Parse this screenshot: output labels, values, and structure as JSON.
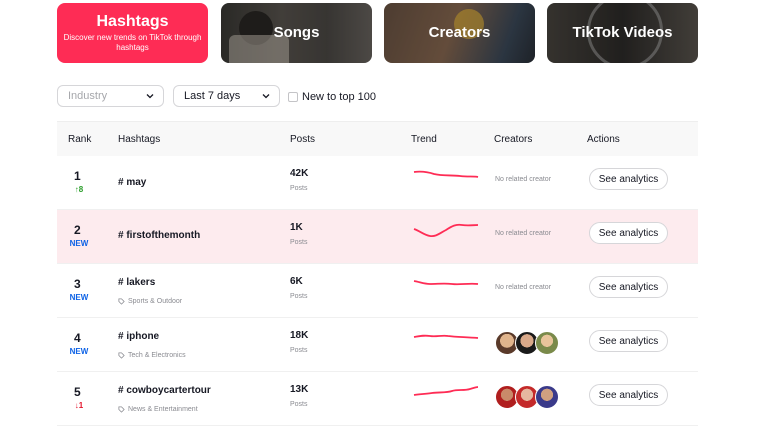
{
  "categories": [
    {
      "title": "Hashtags",
      "desc": "Discover new trends on TikTok through hashtags"
    },
    {
      "title": "Songs"
    },
    {
      "title": "Creators"
    },
    {
      "title": "TikTok Videos"
    }
  ],
  "filters": {
    "industry_placeholder": "Industry",
    "period": "Last 7 days",
    "new_to_top": "New to top 100"
  },
  "table": {
    "headers": {
      "rank": "Rank",
      "hashtags": "Hashtags",
      "posts": "Posts",
      "trend": "Trend",
      "creators": "Creators",
      "actions": "Actions"
    },
    "posts_label": "Posts",
    "no_creator": "No related creator",
    "action_label": "See analytics",
    "rows": [
      {
        "rank": "1",
        "change": "↑8",
        "tag": "# may",
        "category": "",
        "posts": "42K",
        "creators": []
      },
      {
        "rank": "2",
        "change": "NEW",
        "tag": "# firstofthemonth",
        "category": "",
        "posts": "1K",
        "creators": []
      },
      {
        "rank": "3",
        "change": "NEW",
        "tag": "# lakers",
        "category": "Sports & Outdoor",
        "posts": "6K",
        "creators": []
      },
      {
        "rank": "4",
        "change": "NEW",
        "tag": "# iphone",
        "category": "Tech & Electronics",
        "posts": "18K",
        "creators": [
          "creator-avatar",
          "creator-avatar",
          "creator-avatar"
        ]
      },
      {
        "rank": "5",
        "change": "↓1",
        "tag": "# cowboycartertour",
        "category": "News & Entertainment",
        "posts": "13K",
        "creators": [
          "creator-avatar",
          "creator-avatar",
          "creator-avatar"
        ]
      }
    ]
  },
  "colors": {
    "accent": "#fe2c55",
    "new": "#0d62e6",
    "up": "#2a9d2a",
    "down": "#e4142b",
    "highlight": "#fdebee"
  }
}
